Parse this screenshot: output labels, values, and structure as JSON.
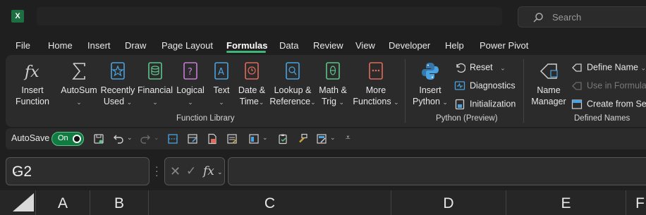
{
  "titlebar": {
    "app_icon": "X",
    "search_placeholder": "Search"
  },
  "tabs": [
    "File",
    "Home",
    "Insert",
    "Draw",
    "Page Layout",
    "Formulas",
    "Data",
    "Review",
    "View",
    "Developer",
    "Help",
    "Power Pivot"
  ],
  "active_tab": "Formulas",
  "ribbon": {
    "function_library": {
      "label": "Function Library",
      "buttons": [
        {
          "line1": "Insert",
          "line2": "Function",
          "icon": "fx-icon"
        },
        {
          "line1": "AutoSum",
          "line2": "",
          "icon": "sigma-icon"
        },
        {
          "line1": "Recently",
          "line2": "Used",
          "icon": "star-book-icon"
        },
        {
          "line1": "Financial",
          "line2": "",
          "icon": "coins-book-icon"
        },
        {
          "line1": "Logical",
          "line2": "",
          "icon": "question-book-icon"
        },
        {
          "line1": "Text",
          "line2": "",
          "icon": "a-book-icon"
        },
        {
          "line1": "Date &",
          "line2": "Time",
          "icon": "clock-book-icon"
        },
        {
          "line1": "Lookup &",
          "line2": "Reference",
          "icon": "magnifier-book-icon"
        },
        {
          "line1": "Math &",
          "line2": "Trig",
          "icon": "theta-book-icon"
        },
        {
          "line1": "More",
          "line2": "Functions",
          "icon": "more-book-icon"
        }
      ]
    },
    "python": {
      "label": "Python (Preview)",
      "insert_line1": "Insert",
      "insert_line2": "Python",
      "reset": "Reset",
      "diagnostics": "Diagnostics",
      "initialization": "Initialization"
    },
    "defined_names": {
      "label": "Defined Names",
      "name_manager_line1": "Name",
      "name_manager_line2": "Manager",
      "define_name": "Define Name",
      "use_in_formula": "Use in Formula",
      "create_from_selection": "Create from Sele"
    }
  },
  "qat": {
    "autosave_label": "AutoSave",
    "toggle_label": "On"
  },
  "formula_bar": {
    "name_box": "G2",
    "fx": "fx",
    "formula": ""
  },
  "columns": [
    "A",
    "B",
    "C",
    "D",
    "E",
    "F"
  ],
  "colors": {
    "accent": "#3fb57a",
    "toggle": "#107c41",
    "background": "#1f1f1f",
    "ribbon": "#2b2b2b"
  }
}
